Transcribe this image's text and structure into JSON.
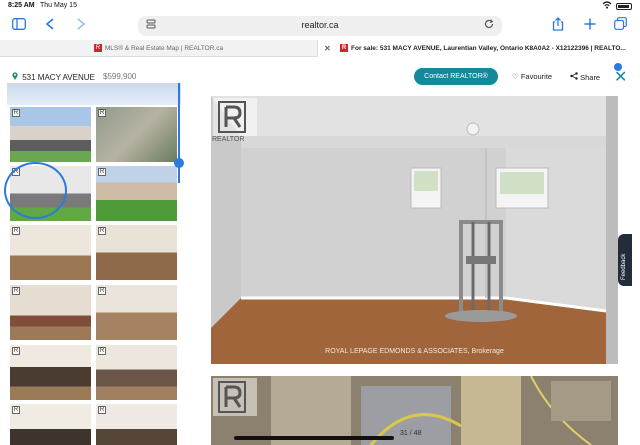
{
  "status": {
    "time": "8:25 AM",
    "date": "Thu May 15"
  },
  "browser": {
    "url": "realtor.ca",
    "tabs": [
      {
        "label": "MLS® & Real Estate Map | REALTOR.ca"
      },
      {
        "label": "For sale: 531 MACY AVENUE, Laurentian Valley, Ontario K8A0A2 - X12122396 | REALTO..."
      }
    ]
  },
  "listing": {
    "address": "531 MACY AVENUE",
    "price": "$599,900",
    "contact_label": "Contact REALTOR®",
    "favourite_label": "Favourite",
    "share_label": "Share"
  },
  "thumbnails": [
    {
      "name": "exterior-front"
    },
    {
      "name": "aerial-view"
    },
    {
      "name": "exterior-side"
    },
    {
      "name": "exterior-rear"
    },
    {
      "name": "living-room-stairs"
    },
    {
      "name": "stairway"
    },
    {
      "name": "living-room"
    },
    {
      "name": "dining-room"
    },
    {
      "name": "kitchen-1"
    },
    {
      "name": "kitchen-2"
    },
    {
      "name": "kitchen-3"
    },
    {
      "name": "kitchen-4"
    }
  ],
  "photo": {
    "watermark": "ROYAL LEPAGE EDMONDS & ASSOCIATES, Brokerage",
    "brand": "REALTOR",
    "counter": "31 / 48"
  },
  "feedback_label": "Feedback",
  "colors": {
    "accent": "#15889c",
    "realtor_red": "#d0232b",
    "ios_blue": "#2a7ae2"
  }
}
